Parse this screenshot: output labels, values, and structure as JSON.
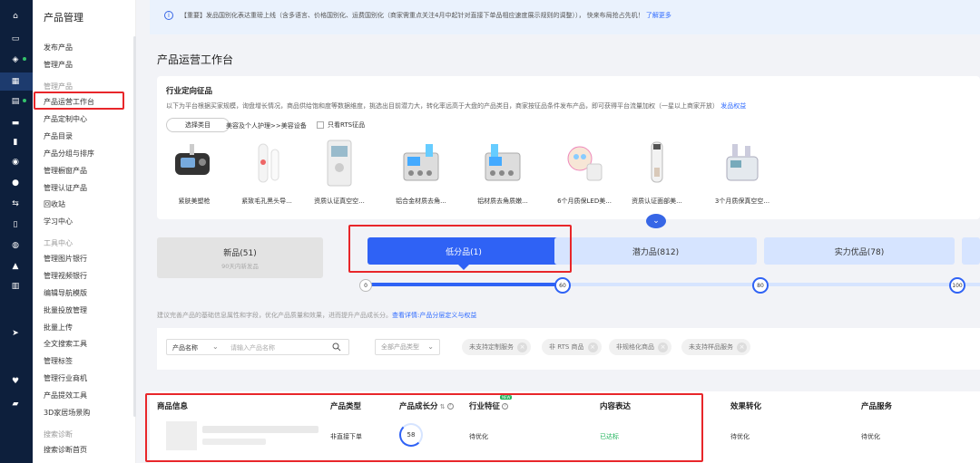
{
  "nav": {
    "title": "产品管理"
  },
  "menu": {
    "group1": [
      "发布产品",
      "管理产品"
    ],
    "group2_label": "管理产品",
    "group2": [
      "产品运营工作台",
      "产品定制中心",
      "产品目录",
      "产品分组与排序",
      "管理橱窗产品",
      "管理认证产品",
      "回收站",
      "学习中心"
    ],
    "group3_label": "工具中心",
    "group3": [
      "管理图片银行",
      "管理视频银行",
      "编辑导航模版",
      "批量投放管理",
      "批量上传",
      "全文搜索工具",
      "管理标签",
      "管理行业商机",
      "产品提效工具",
      "3D家居场景购"
    ],
    "group4_label": "搜索诊断",
    "group4": [
      "搜索诊断首页"
    ]
  },
  "notice": {
    "text": "【重要】发品国别化表达重磅上线（含多语言、价格国别化、运费国别化（商家需重点关注4月中起针对直接下单品相应速度展示规则的调整））， 快来布局抢占先机！",
    "link": "了解更多"
  },
  "page_title": "产品运营工作台",
  "industry": {
    "heading": "行业定向征品",
    "desc": "以下为平台根据买家规模，询盘增长情况，商品供给饱和度等数据维度，挑选出目前潜力大，转化率远高于大盘的产品类目，商家按征品条件发布产品，即可获得平台流量加权（一星以上商家开放）",
    "desc_link": "发品权益",
    "select_btn": "选择类目",
    "path": "美容及个人护理>>美容设备",
    "checkbox": "只看RTS征品",
    "products": [
      "紧肤美塑枪",
      "紧致毛孔黑头导...",
      "资质认证真空空...",
      "铝合金材质去角...",
      "铝材质去角质嫩...",
      "6个月质保LED美...",
      "资质认证面部美...",
      "3个月质保真空空..."
    ]
  },
  "tabs": {
    "new": {
      "label": "新品(51)",
      "sub": "90天内新发品"
    },
    "low": "低分品(1)",
    "potential": "潜力品(812)",
    "strong": "实力优品(78)"
  },
  "progress": {
    "nodes": [
      "0",
      "60",
      "80",
      "100"
    ],
    "fill_fraction": 0.31
  },
  "hint": {
    "text": "建议完善产品的基础信息属性和字段，优化产品质量和效果，进而提升产品成长分。",
    "link": "查看详情:产品分层定义与权益"
  },
  "filter": {
    "field": "产品名称",
    "placeholder": "请输入产品名称",
    "type_select": "全部产品类型",
    "pills": [
      "未支持定制服务",
      "非 RTS 商品",
      "非规格化商品",
      "未支持样品服务"
    ]
  },
  "table": {
    "headers": [
      "商品信息",
      "产品类型",
      "产品成长分",
      "行业特征",
      "内容表达",
      "效果转化",
      "产品服务"
    ],
    "new_badge": "NEW",
    "row": {
      "type": "非直接下单",
      "score": "58",
      "industry": "待优化",
      "content": "已达标",
      "effect": "待优化",
      "service": "待优化"
    }
  },
  "colors": {
    "accent": "#2f62f5",
    "nav_bg": "#0d1f3c",
    "highlight": "#e8262a",
    "ok": "#1fb35b"
  }
}
